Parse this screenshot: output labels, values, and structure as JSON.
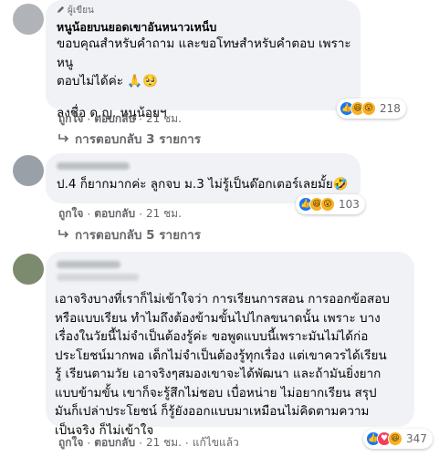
{
  "comment1": {
    "badge": "ผู้เขียน",
    "author": "หนูน้อยบนยอดเขาอันหนาวเหน็บ",
    "lines": [
      "ขอบคุณสำหรับคำถาม และขอโทษสำหรับคำตอบ เพราะหนู",
      "ตอบไม่ได้ค่ะ 🙏🥺",
      "",
      "ลงชื่อ ด.ญ. หนูน้อยฯ"
    ],
    "like_label": "ถูกใจ",
    "reply_label": "ตอบกลับ",
    "time": "21 ชม.",
    "reaction_count": "218",
    "replies_label": "การตอบกลับ 3 รายการ"
  },
  "comment2": {
    "author": "Nattaya Na",
    "lines": [
      "ป.4 ก็ยากมากค่ะ ลูกจบ ม.3 ไม่รู้เป็นด๊อกเตอร์เลยมั้ย🤣"
    ],
    "like_label": "ถูกใจ",
    "reply_label": "ตอบกลับ",
    "time": "21 ชม.",
    "reaction_count": "103",
    "replies_label": "การตอบกลับ 5 รายการ"
  },
  "comment3": {
    "lines": [
      "เอาจริงบางที่เราก็ไม่เข้าใจว่า การเรียนการสอน การออกข้อสอบ",
      "หรือแบบเรียน ทำไมถึงต้องข้ามขั้นไปไกลขนาดนั้น เพราะ บาง",
      "เรื่องในวัยนี้ไม่จำเป็นต้องรู้ค่ะ ขอพูดแบบนี้เพราะมันไม่ได้ก่อ",
      "ประโยชน์มากพอ เด็กไม่จำเป็นต้องรู้ทุกเรื่อง แต่เขาควรได้เรียน",
      "รู้ เรียนตามวัย เอาจริงๆสมองเขาจะได้พัฒนา และถ้ามันยิ่งยาก",
      "แบบข้ามขั้น เขาก็จะรู้สึกไม่ชอบ เบื่อหน่าย ไม่อยากเรียน สรุป",
      "มันก็เปล่าประโยชน์ ก็รู้ยังออกแบบมาเหมือนไม่คิดตามความ",
      "เป็นจริง ก็ไม่เข้าใจ"
    ],
    "like_label": "ถูกใจ",
    "reply_label": "ตอบกลับ",
    "time": "21 ชม.",
    "edited_label": "แก้ไขแล้ว",
    "reaction_count": "347"
  },
  "separator": "·",
  "icons": {
    "author_badge": "pen-icon",
    "reply_arrow": "reply-arrow-icon"
  }
}
